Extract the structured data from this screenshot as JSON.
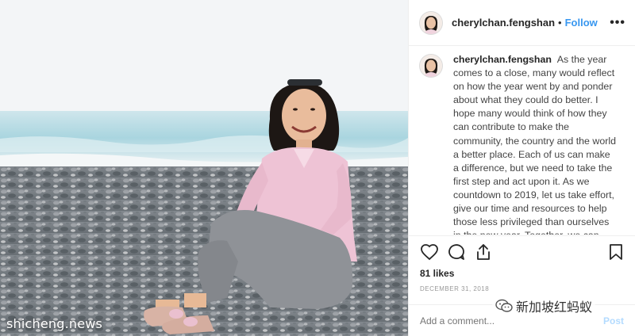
{
  "photo": {
    "watermark": "shicheng.news"
  },
  "post": {
    "username": "cherylchan.fengshan",
    "separator": "•",
    "follow_label": "Follow",
    "more_label": "•••",
    "caption": "As the year comes to a close, many would reflect on how the year went by and ponder about what they could do better. I hope many would think of how they can contribute to make the community, the country and the world a better place. Each of us can make a difference, but we need to take the first step and act upon it. As we countdown to 2019, let us take effort, give our time and resources to help those less privileged than ourselves in the new year. Together, we can make each day more encouraging and pleasant for everyone. I sincerely wish",
    "likes": "81 likes",
    "date": "DECEMBER 31, 2018",
    "comment_placeholder": "Add a comment...",
    "post_label": "Post"
  },
  "overlay": {
    "watermark_right": "新加坡红蚂蚁"
  },
  "icons": {
    "like": "heart-icon",
    "comment": "comment-icon",
    "share": "share-icon",
    "save": "bookmark-icon",
    "watermark_logo": "wechat-icon"
  },
  "colors": {
    "follow": "#3897f0",
    "post_disabled": "#b3dbff",
    "text": "#262626",
    "muted": "#999999"
  }
}
